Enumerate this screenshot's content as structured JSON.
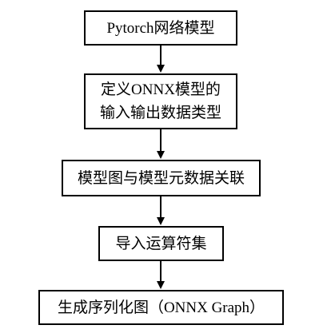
{
  "flowchart": {
    "steps": [
      {
        "lines": [
          "Pytorch网络模型"
        ]
      },
      {
        "lines": [
          "定义ONNX模型的",
          "输入输出数据类型"
        ]
      },
      {
        "lines": [
          "模型图与模型元数据关联"
        ]
      },
      {
        "lines": [
          "导入运算符集"
        ]
      },
      {
        "lines": [
          "生成序列化图（ONNX Graph）"
        ]
      }
    ],
    "colors": {
      "stroke": "#000000",
      "fill": "#ffffff"
    }
  }
}
